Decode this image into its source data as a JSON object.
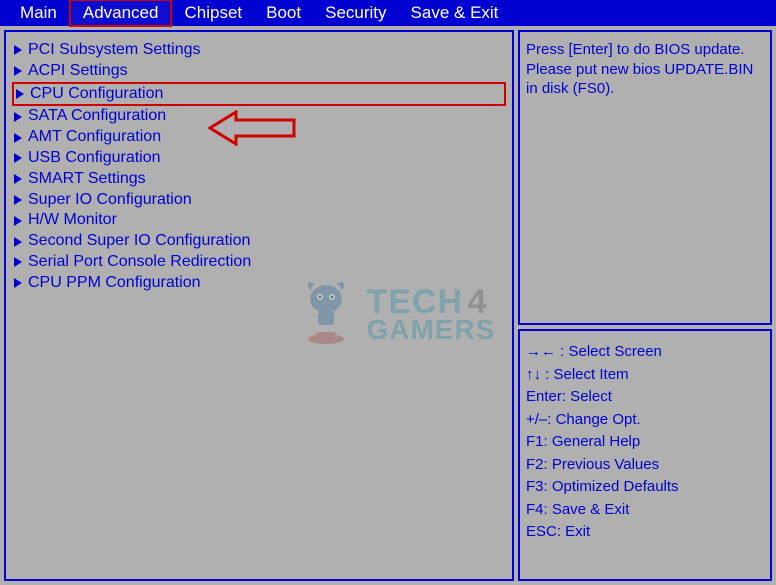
{
  "menubar": {
    "items": [
      {
        "label": "Main",
        "active": false
      },
      {
        "label": "Advanced",
        "active": true
      },
      {
        "label": "Chipset",
        "active": false
      },
      {
        "label": "Boot",
        "active": false
      },
      {
        "label": "Security",
        "active": false
      },
      {
        "label": "Save & Exit",
        "active": false
      }
    ]
  },
  "left_menu": {
    "items": [
      {
        "label": "PCI Subsystem Settings",
        "highlighted": false
      },
      {
        "label": "ACPI Settings",
        "highlighted": false
      },
      {
        "label": "CPU Configuration",
        "highlighted": true
      },
      {
        "label": "SATA Configuration",
        "highlighted": false
      },
      {
        "label": "AMT Configuration",
        "highlighted": false
      },
      {
        "label": "USB Configuration",
        "highlighted": false
      },
      {
        "label": "SMART Settings",
        "highlighted": false
      },
      {
        "label": "Super IO Configuration",
        "highlighted": false
      },
      {
        "label": "H/W Monitor",
        "highlighted": false
      },
      {
        "label": "Second Super IO Configuration",
        "highlighted": false
      },
      {
        "label": "Serial Port Console Redirection",
        "highlighted": false
      },
      {
        "label": "CPU PPM Configuration",
        "highlighted": false
      }
    ]
  },
  "right_top": {
    "lines": [
      "Press [Enter] to do BIOS update.",
      "Please put new bios UPDATE.BIN in disk (FS0)."
    ]
  },
  "right_bottom": {
    "lines": [
      "→← : Select Screen",
      "↑↓ : Select Item",
      "Enter: Select",
      "+/–: Change Opt.",
      "F1: General Help",
      "F2: Previous Values",
      "F3: Optimized Defaults",
      "F4: Save & Exit",
      "ESC: Exit"
    ]
  },
  "watermark": {
    "text1": "TECH",
    "text2": "4",
    "text3": "GAMERS"
  },
  "colors": {
    "menubar_bg": "#0000d0",
    "panel_bg": "#b0b0b0",
    "text": "#0000d0",
    "highlight_border": "#d00000"
  }
}
